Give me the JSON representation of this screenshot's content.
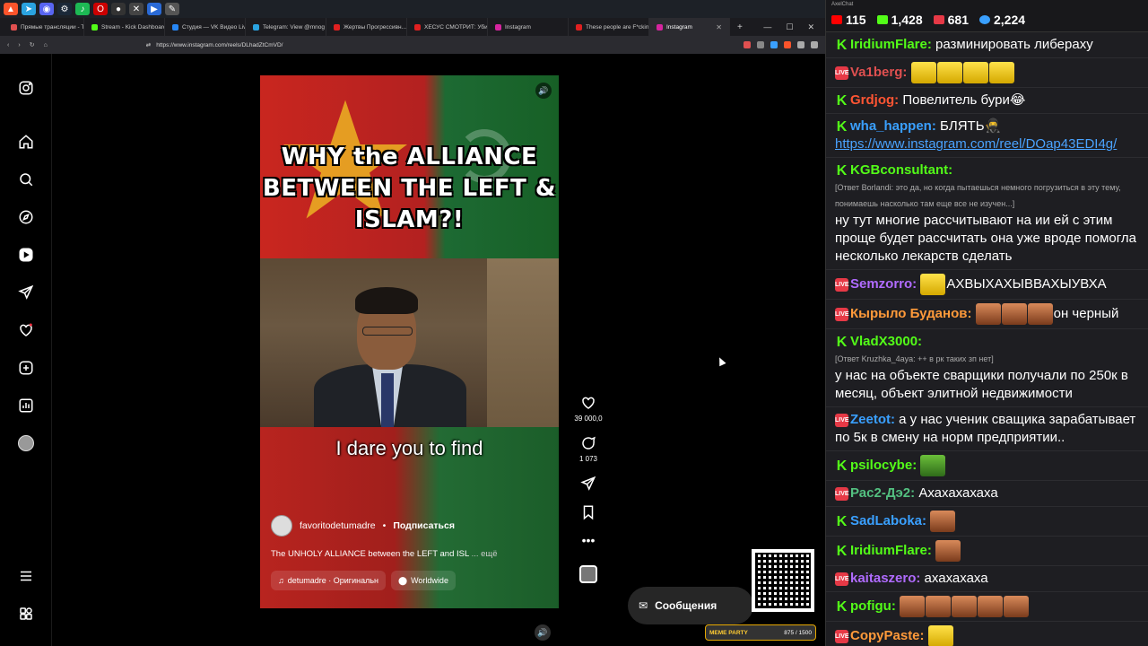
{
  "browser": {
    "tabs": [
      {
        "label": "Прямые трансляции - Tw",
        "color": "#e05050"
      },
      {
        "label": "Stream - Kick Dashboard",
        "color": "#53fc18"
      },
      {
        "label": "Студия — VK Видео Live",
        "color": "#2787f5"
      },
      {
        "label": "Telegram: View @mnog",
        "color": "#2aa3e0"
      },
      {
        "label": "Жертвы Прогрессивн...",
        "color": "#e02020"
      },
      {
        "label": "ХЕСУС СМОТРИТ: Убил",
        "color": "#e02020"
      },
      {
        "label": "Instagram",
        "color": "#d6249f"
      },
      {
        "label": "These people are F*ckin",
        "color": "#e02020"
      },
      {
        "label": "Instagram",
        "color": "#d6249f"
      }
    ],
    "url": "https://www.instagram.com/reels/DLhadZtCmVD/"
  },
  "reel": {
    "headline": "WHY the ALLIANCE BETWEEN THE LEFT & ISLAM?!",
    "subtitle": "I dare you to find",
    "author": "favoritodetumadre",
    "follow": "Подписаться",
    "description": "The UNHOLY ALLIANCE between the LEFT and ISL",
    "more": "... ещё",
    "audio": "detumadre · Оригинальн",
    "location": "Worldwide",
    "likes": "39 000,0",
    "comments": "1 073"
  },
  "messages_button": "Сообщения",
  "meme_widget": {
    "label": "MEME PARTY",
    "value": "875 / 1500"
  },
  "chat": {
    "app": "AxelChat",
    "stats": {
      "youtube": "115",
      "kick": "1,428",
      "vk": "681",
      "viewers": "2,224"
    },
    "messages": [
      {
        "platform": "kick",
        "user": "IridiumFlare:",
        "color": "#53fc18",
        "text": "разминировать либераху"
      },
      {
        "platform": "vk",
        "user": "Va1berg:",
        "color": "#e05050",
        "text": "",
        "emotes": 4
      },
      {
        "platform": "kick",
        "user": "Grdjog:",
        "color": "#ff5533",
        "text": "Повелитель бури😂"
      },
      {
        "platform": "kick",
        "user": "wha_happen:",
        "color": "#3aa0ff",
        "text": "БЛЯТЬ🥷",
        "link": "https://www.instagram.com/reel/DOap43EDI4g/"
      },
      {
        "platform": "kick",
        "user": "KGBconsultant:",
        "color": "#53fc18",
        "reply": "[Ответ Borlandi: это да, но когда пытаешься немного погрузиться в эту тему, понимаешь насколько там еще все не изучен...]",
        "text": "ну тут многие рассчитывают на ии ей с этим проще будет рассчитать она уже вроде помогла несколько лекарств сделать"
      },
      {
        "platform": "vk",
        "user": "Semzorro:",
        "color": "#b06bff",
        "text": "АХВЫХАХЫВВАХЫУВХА",
        "emotes": 1
      },
      {
        "platform": "vk",
        "user": "Кырыло Буданов:",
        "color": "#ff9a3a",
        "text": "он черный",
        "emotes": 3
      },
      {
        "platform": "kick",
        "user": "VladX3000:",
        "color": "#53fc18",
        "reply": "[Ответ Kruzhka_4aya: ++ в рк таких зп нет]",
        "text": "у нас на объекте сварщики получали по 250к в месяц, объект элитной недвижимости"
      },
      {
        "platform": "vk",
        "user": "Zeetot:",
        "color": "#3aa0ff",
        "text": "а у нас ученик свaщика зарабатывает по 5к в смену на норм предприятии.."
      },
      {
        "platform": "kick",
        "user": "psilocybe:",
        "color": "#53fc18",
        "text": "",
        "emotes": 1
      },
      {
        "platform": "vk",
        "user": "Рас2-Дэ2:",
        "color": "#53c080",
        "text": "Ахахахахаха"
      },
      {
        "platform": "kick",
        "user": "SadLaboka:",
        "color": "#3aa0ff",
        "text": "",
        "emotes": 1
      },
      {
        "platform": "kick",
        "user": "IridiumFlare:",
        "color": "#53fc18",
        "text": "",
        "emotes": 1
      },
      {
        "platform": "vk",
        "user": "kaitaszero:",
        "color": "#b06bff",
        "text": "ахахахаха"
      },
      {
        "platform": "kick",
        "user": "pofigu:",
        "color": "#53fc18",
        "text": "",
        "emotes": 5
      },
      {
        "platform": "vk",
        "user": "CopyPaste:",
        "color": "#ff9a3a",
        "text": "",
        "emotes": 1
      }
    ]
  }
}
